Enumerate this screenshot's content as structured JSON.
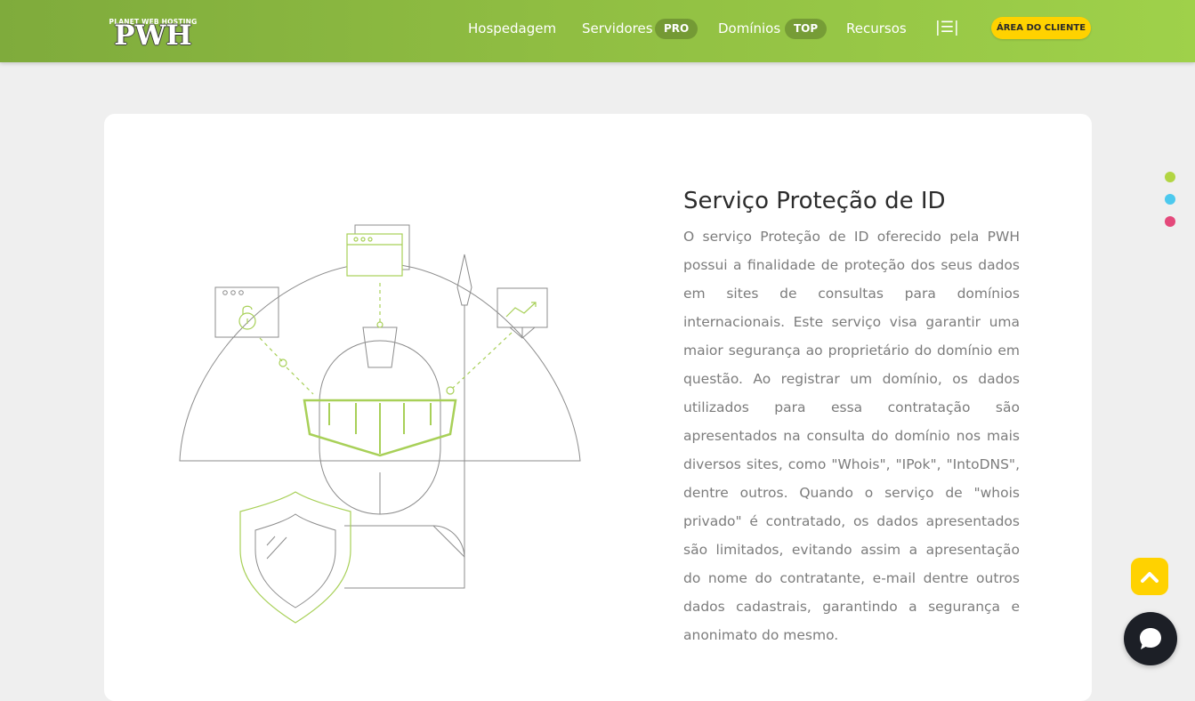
{
  "header": {
    "logo": {
      "tagline": "PLANET WEB HOSTING",
      "mark": "PWH"
    },
    "nav": {
      "hospedagem": "Hospedagem",
      "servidores": "Servidores",
      "servidores_badge": "PRO",
      "dominios": "Domínios",
      "dominios_badge": "TOP",
      "recursos": "Recursos",
      "menu_icon": "|☰|"
    },
    "client_button": "ÁREA DO CLIENTE"
  },
  "main": {
    "title": "Serviço Proteção de ID",
    "description": "O serviço Proteção de ID oferecido pela PWH possui a finalidade de proteção dos seus dados em sites de consultas para domínios internacionais. Este serviço visa garantir uma maior segurança ao proprietário do domínio em questão. Ao registrar um domínio, os dados utilizados para essa contratação são apresentados na consulta do domínio nos mais diversos sites, como \"Whois\", \"IPok\", \"IntoDNS\", dentre outros. Quando o serviço de \"whois privado\" é contratado, os dados apresentados são limitados, evitando assim a apresentação do nome do contratante, e-mail dentre outros dados cadastrais, garantindo a segurança e anonimato do mesmo."
  },
  "side_dots": [
    "#b2d542",
    "#4cc9ee",
    "#e4497b"
  ],
  "colors": {
    "accent_green": "#9fd14a",
    "yellow": "#ffd200",
    "chat_dark": "#1c1f26"
  },
  "icons": {
    "illustration": "knight-shield-security-icon",
    "scroll_top": "chevron-up-icon",
    "chat": "chat-bubble-icon"
  }
}
